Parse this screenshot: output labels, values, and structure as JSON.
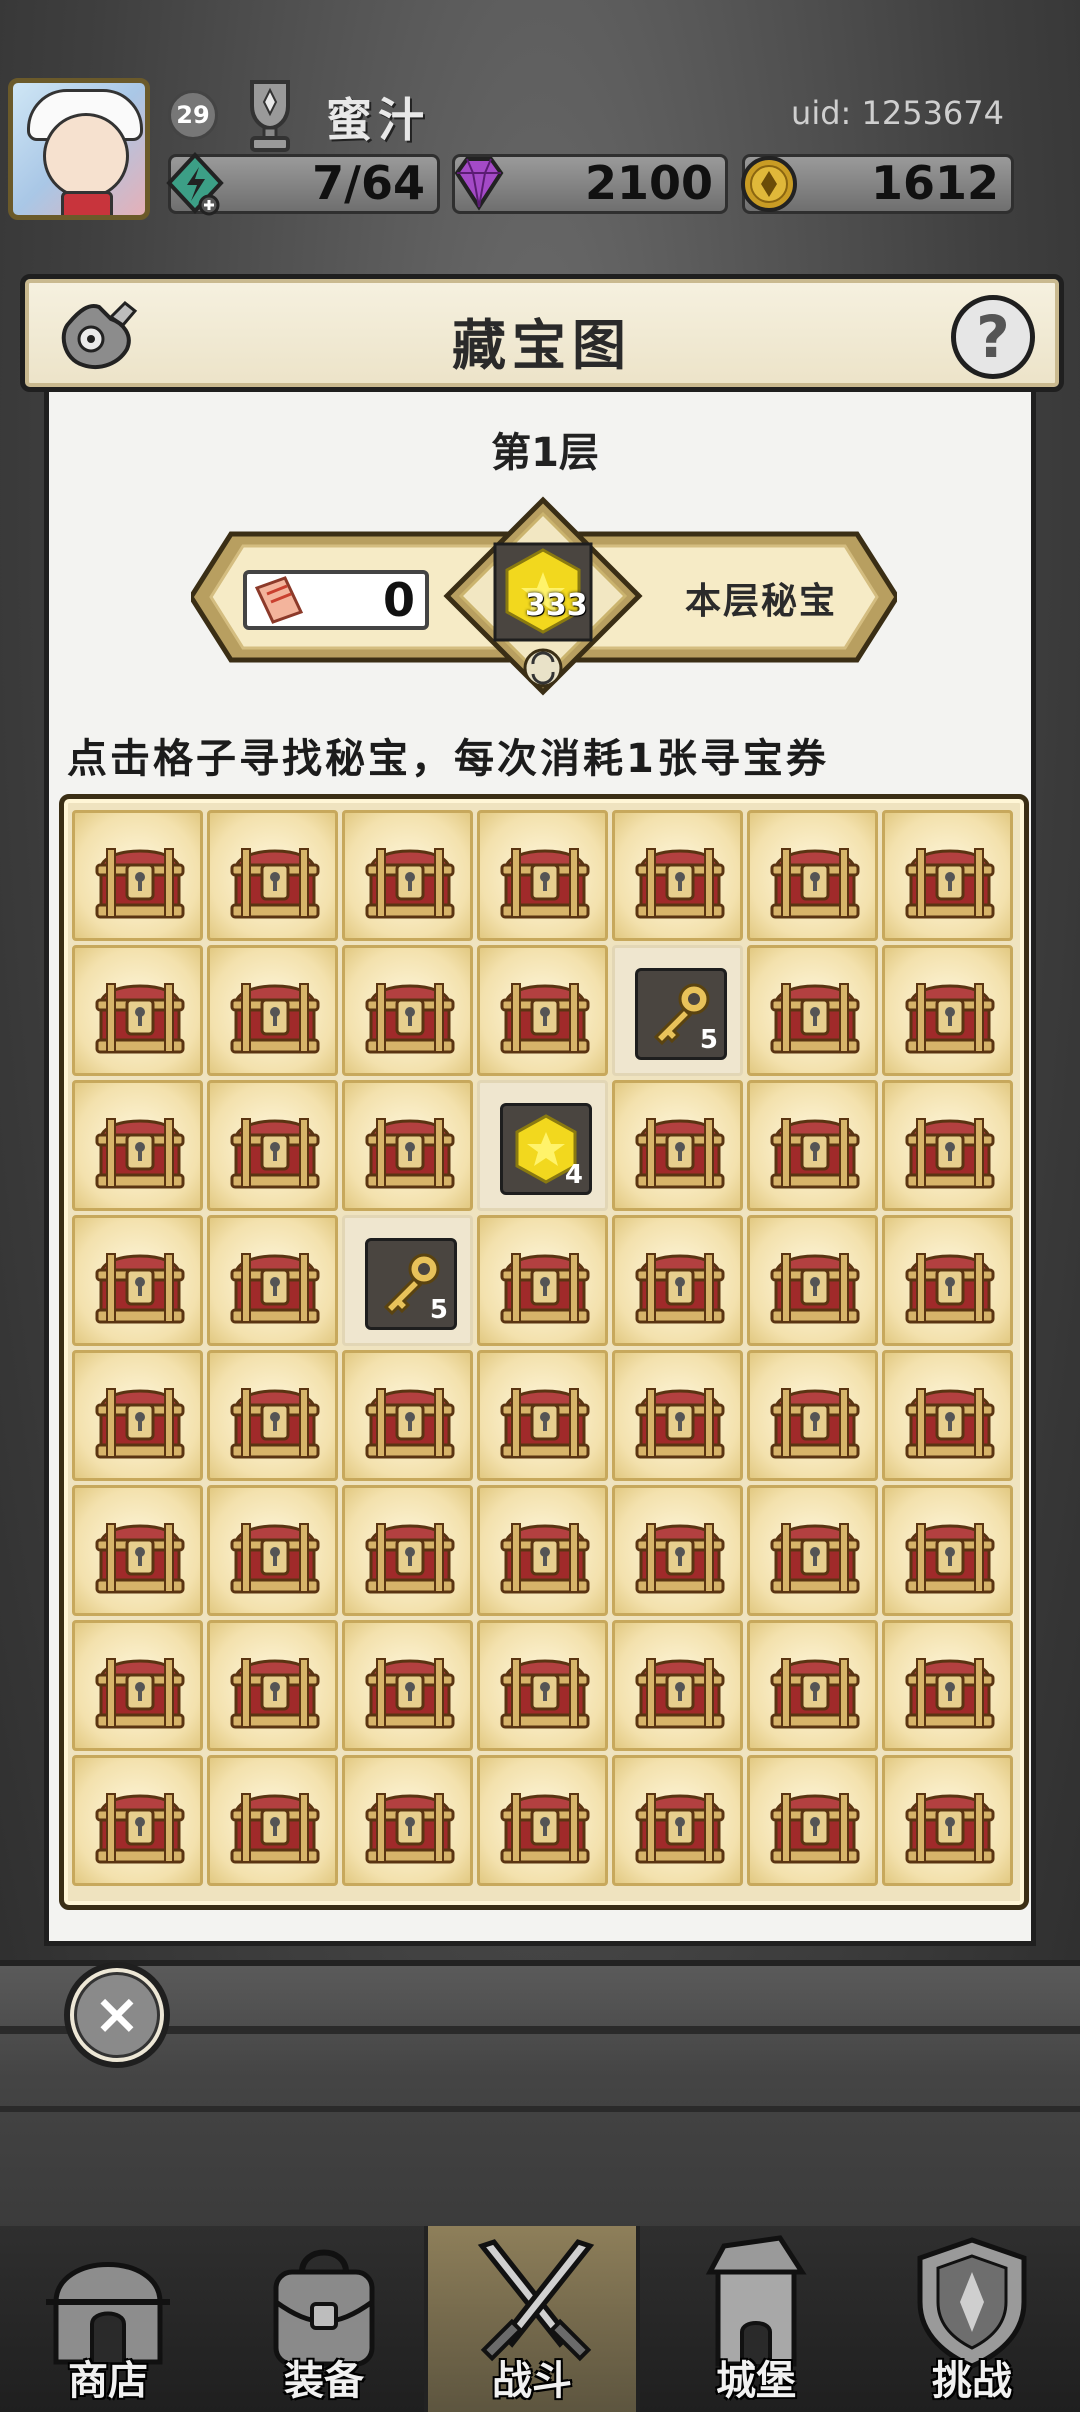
{
  "player": {
    "level": "29",
    "name": "蜜汁",
    "uid": "uid: 1253674"
  },
  "resources": {
    "energy": "7/64",
    "gems": "2100",
    "coins": "1612"
  },
  "panel": {
    "title": "藏宝图",
    "help_label": "?",
    "floor": "第1层",
    "tickets": "0",
    "secret_treasure_count": "333",
    "secret_label": "本层秘宝",
    "instruction": "点击格子寻找秘宝，每次消耗1张寻宝券"
  },
  "grid": {
    "rows": 8,
    "cols": 7,
    "revealed": [
      {
        "row": 2,
        "col": 5,
        "item": "key",
        "qty": "5"
      },
      {
        "row": 3,
        "col": 4,
        "item": "gem",
        "qty": "4"
      },
      {
        "row": 4,
        "col": 3,
        "item": "key",
        "qty": "5"
      }
    ]
  },
  "close_label": "×",
  "nav": {
    "items": [
      {
        "label": "商店",
        "icon": "shop-icon"
      },
      {
        "label": "装备",
        "icon": "bag-icon"
      },
      {
        "label": "战斗",
        "icon": "crossed-swords-icon",
        "active": true
      },
      {
        "label": "城堡",
        "icon": "castle-icon"
      },
      {
        "label": "挑战",
        "icon": "shield-icon"
      }
    ]
  },
  "colors": {
    "panel_bg": "#f3f3f1",
    "grid_cell": "#f3e1ad",
    "chest_red": "#a02a2a",
    "gem_yellow": "#f2d81e"
  }
}
